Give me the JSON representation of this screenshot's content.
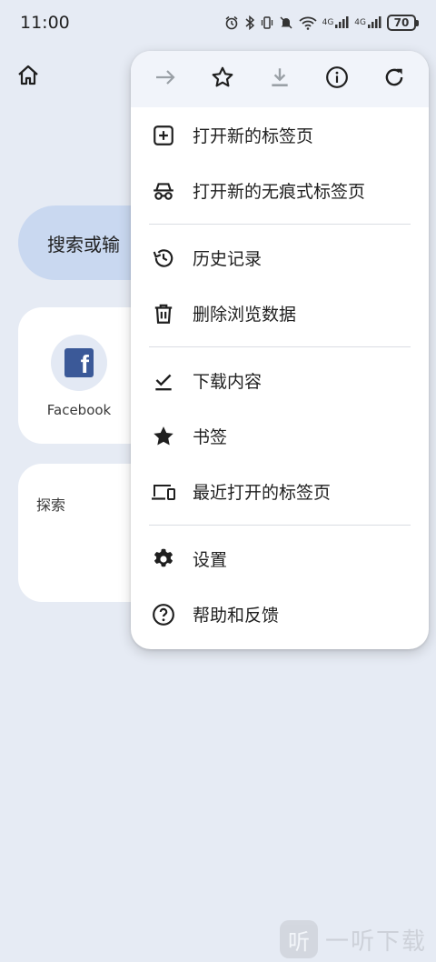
{
  "status_bar": {
    "time": "11:00",
    "battery": "70",
    "network_1": "4G",
    "network_2": "4G"
  },
  "background_page": {
    "search_placeholder": "搜索或输",
    "shortcuts": [
      {
        "label": "Facebook",
        "icon": "facebook-icon"
      }
    ],
    "explore_title": "探索"
  },
  "menu": {
    "toolbar": [
      {
        "name": "forward-button",
        "icon": "arrow-forward-icon",
        "enabled": false
      },
      {
        "name": "bookmark-star-button",
        "icon": "star-outline-icon",
        "enabled": true
      },
      {
        "name": "download-page-button",
        "icon": "download-icon",
        "enabled": false
      },
      {
        "name": "page-info-button",
        "icon": "info-icon",
        "enabled": true
      },
      {
        "name": "reload-button",
        "icon": "refresh-icon",
        "enabled": true
      }
    ],
    "items": [
      {
        "label": "打开新的标签页",
        "icon": "add-box-icon"
      },
      {
        "label": "打开新的无痕式标签页",
        "icon": "incognito-icon"
      },
      {
        "label": "历史记录",
        "icon": "history-icon"
      },
      {
        "label": "删除浏览数据",
        "icon": "trash-icon"
      },
      {
        "label": "下载内容",
        "icon": "download-done-icon"
      },
      {
        "label": "书签",
        "icon": "star-filled-icon"
      },
      {
        "label": "最近打开的标签页",
        "icon": "devices-icon"
      },
      {
        "label": "设置",
        "icon": "gear-icon"
      },
      {
        "label": "帮助和反馈",
        "icon": "help-icon"
      }
    ]
  },
  "watermark": {
    "badge": "听",
    "text": "一听下载"
  },
  "colors": {
    "background": "#e6ebf4",
    "menu_toolbar": "#f1f4fa",
    "search_pill": "#c9d8f0",
    "icon": "#1f1f1f",
    "icon_disabled": "#9aa0a6"
  }
}
